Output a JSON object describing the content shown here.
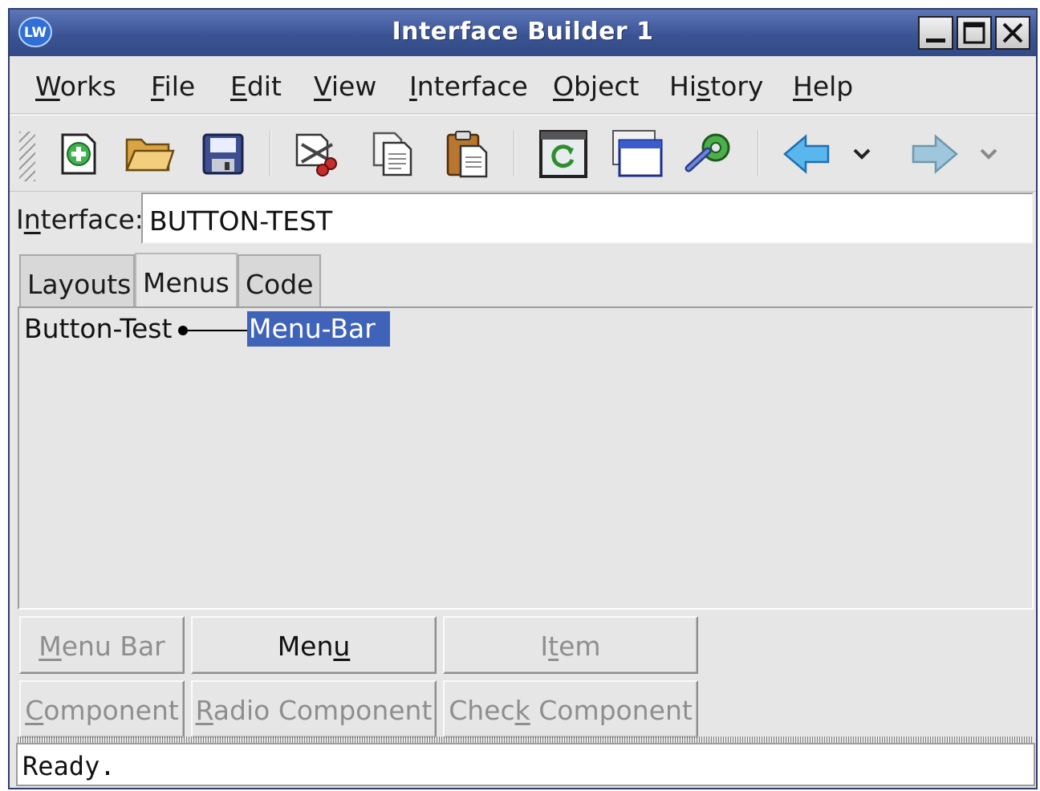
{
  "window": {
    "title": "Interface Builder 1",
    "app_icon": "LW"
  },
  "menubar": {
    "items": [
      {
        "pre": "",
        "u": "W",
        "post": "orks"
      },
      {
        "pre": "",
        "u": "F",
        "post": "ile"
      },
      {
        "pre": "",
        "u": "E",
        "post": "dit"
      },
      {
        "pre": "",
        "u": "V",
        "post": "iew"
      },
      {
        "pre": "",
        "u": "I",
        "post": "nterface"
      },
      {
        "pre": "",
        "u": "O",
        "post": "bject"
      },
      {
        "pre": "Hi",
        "u": "s",
        "post": "tory"
      },
      {
        "pre": "",
        "u": "H",
        "post": "elp"
      }
    ]
  },
  "toolbar": {
    "icons": [
      "new-icon",
      "open-folder-icon",
      "save-icon",
      "cut-icon",
      "copy-icon",
      "paste-icon",
      "refresh-icon",
      "window-icon",
      "wrench-gear-icon",
      "back-arrow-icon",
      "dropdown-chevron-icon",
      "forward-arrow-icon",
      "dropdown-chevron-icon"
    ]
  },
  "interface": {
    "label_pre": "I",
    "label_u": "n",
    "label_post": "terface:",
    "value": "BUTTON-TEST"
  },
  "tabs": [
    "Layouts",
    "Menus",
    "Code"
  ],
  "tree": {
    "root": "Button-Test",
    "child": "Menu-Bar"
  },
  "buttons": {
    "menu_bar": {
      "pre": "",
      "u": "M",
      "post": "enu Bar"
    },
    "menu": {
      "pre": "Men",
      "u": "u",
      "post": ""
    },
    "item": {
      "pre": "I",
      "u": "t",
      "post": "em"
    },
    "component": {
      "pre": "",
      "u": "C",
      "post": "omponent"
    },
    "radio_component": {
      "pre": "",
      "u": "R",
      "post": "adio Component"
    },
    "check_component": {
      "pre": "Chec",
      "u": "k",
      "post": " Component"
    }
  },
  "status": "Ready.",
  "colors": {
    "titlebar": "#3a5494",
    "selection": "#3f63b9",
    "background": "#e6e6e6"
  }
}
